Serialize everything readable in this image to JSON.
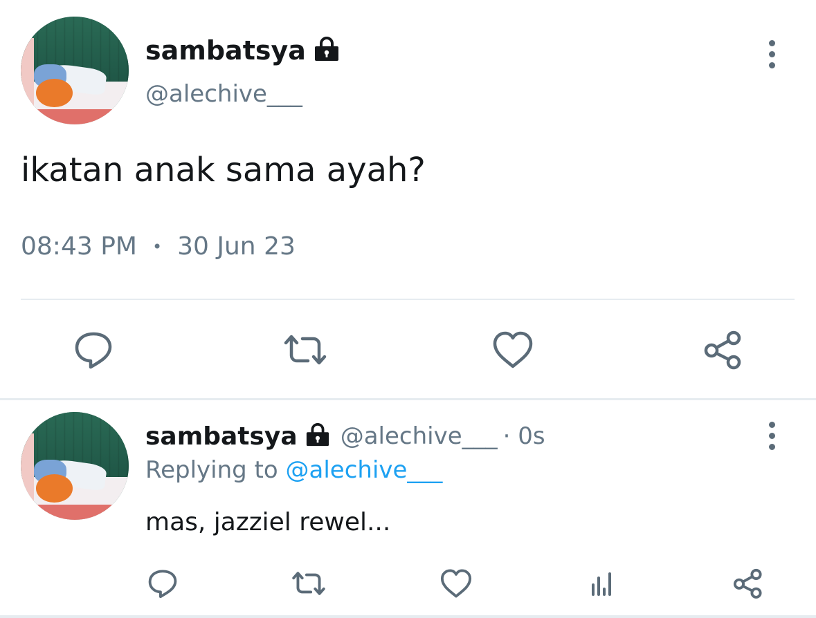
{
  "main_tweet": {
    "display_name": "sambatsya",
    "handle": "@alechive___",
    "text": "ikatan anak sama ayah?",
    "time": "08:43 PM",
    "separator": "•",
    "date": "30 Jun 23"
  },
  "reply_tweet": {
    "display_name": "sambatsya",
    "handle": "@alechive___",
    "age": "· 0s",
    "replying_prefix": "Replying to",
    "replying_mention": "@alechive___",
    "text": "mas, jazziel rewel..."
  },
  "icons": {
    "lock": "lock-icon",
    "more": "more-vertical-icon",
    "reply": "comment-icon",
    "retweet": "retweet-icon",
    "like": "heart-icon",
    "share": "share-icon",
    "analytics": "analytics-icon"
  },
  "colors": {
    "text": "#14171a",
    "secondary": "#657786",
    "mention": "#1da1f2",
    "icon": "#5b6b78",
    "divider": "#e6ecf0"
  }
}
